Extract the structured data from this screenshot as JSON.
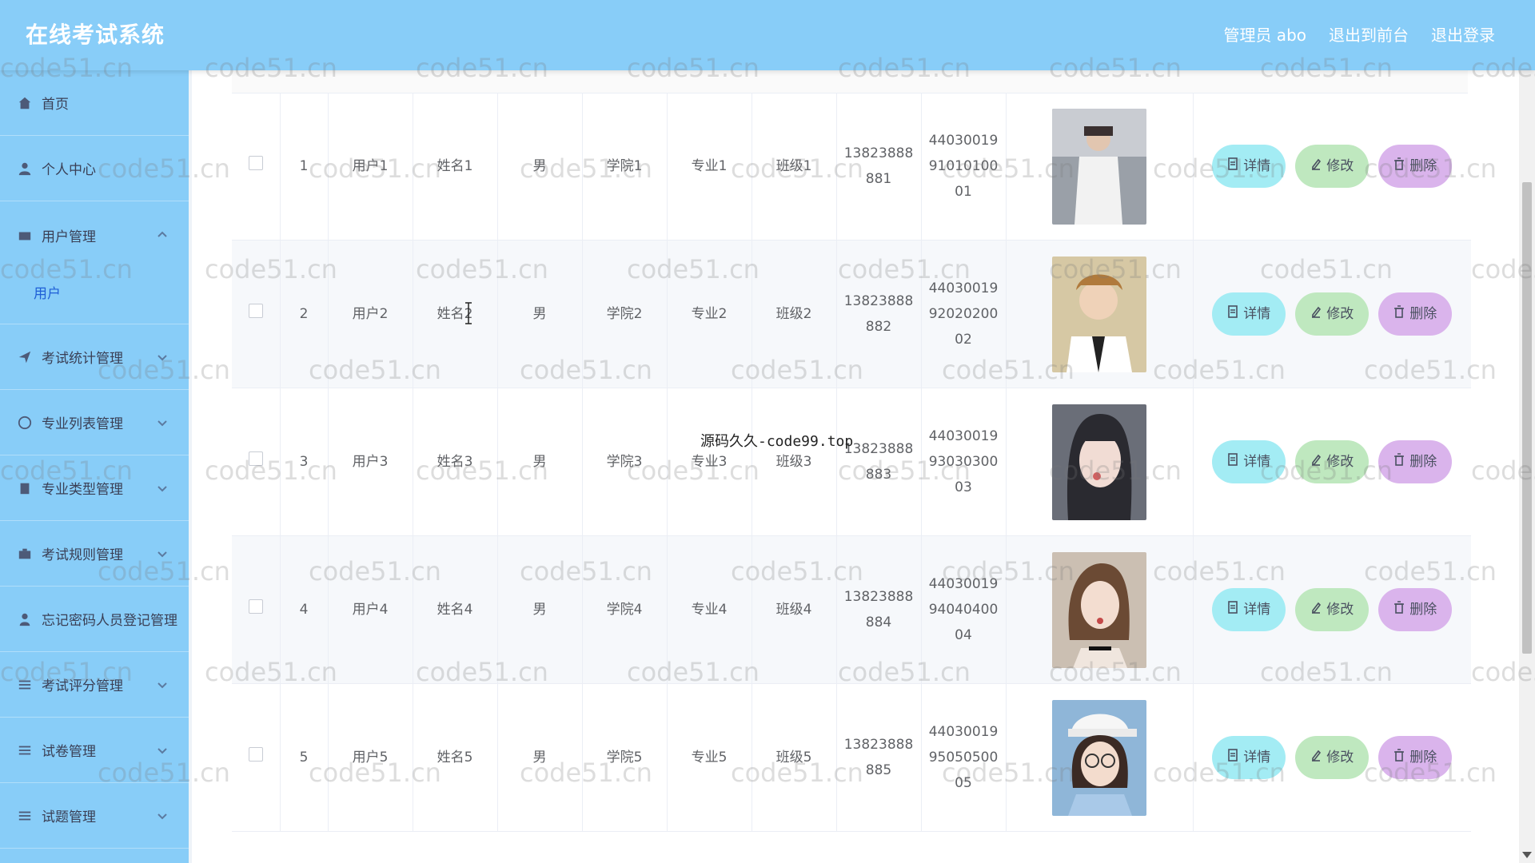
{
  "header": {
    "app_title": "在线考试系统",
    "admin": "管理员 abo",
    "link_front": "退出到前台",
    "link_logout": "退出登录"
  },
  "sidebar": {
    "items": [
      {
        "label": "首页",
        "icon": "home-icon"
      },
      {
        "label": "个人中心",
        "icon": "user-icon"
      },
      {
        "label": "用户管理",
        "icon": "users-icon",
        "submenu": "用户"
      },
      {
        "label": "考试统计管理",
        "icon": "send-icon"
      },
      {
        "label": "专业列表管理",
        "icon": "globe-icon"
      },
      {
        "label": "专业类型管理",
        "icon": "clipboard-icon"
      },
      {
        "label": "考试规则管理",
        "icon": "briefcase-icon"
      },
      {
        "label": "忘记密码人员登记管理",
        "icon": "person-icon"
      },
      {
        "label": "考试评分管理",
        "icon": "sliders-icon"
      },
      {
        "label": "试卷管理",
        "icon": "list-icon"
      },
      {
        "label": "试题管理",
        "icon": "list-icon"
      }
    ]
  },
  "table": {
    "rows": [
      {
        "index": "1",
        "account": "用户1",
        "name": "姓名1",
        "gender": "男",
        "college": "学院1",
        "major": "专业1",
        "class": "班级1",
        "phone_a": "13823888",
        "phone_b": "881",
        "id_a": "44030019",
        "id_b": "91010100",
        "id_c": "01"
      },
      {
        "index": "2",
        "account": "用户2",
        "name": "姓名2",
        "gender": "男",
        "college": "学院2",
        "major": "专业2",
        "class": "班级2",
        "phone_a": "13823888",
        "phone_b": "882",
        "id_a": "44030019",
        "id_b": "92020200",
        "id_c": "02"
      },
      {
        "index": "3",
        "account": "用户3",
        "name": "姓名3",
        "gender": "男",
        "college": "学院3",
        "major": "专业3",
        "class": "班级3",
        "phone_a": "13823888",
        "phone_b": "883",
        "id_a": "44030019",
        "id_b": "93030300",
        "id_c": "03"
      },
      {
        "index": "4",
        "account": "用户4",
        "name": "姓名4",
        "gender": "男",
        "college": "学院4",
        "major": "专业4",
        "class": "班级4",
        "phone_a": "13823888",
        "phone_b": "884",
        "id_a": "44030019",
        "id_b": "94040400",
        "id_c": "04"
      },
      {
        "index": "5",
        "account": "用户5",
        "name": "姓名5",
        "gender": "男",
        "college": "学院5",
        "major": "专业5",
        "class": "班级5",
        "phone_a": "13823888",
        "phone_b": "885",
        "id_a": "44030019",
        "id_b": "95050500",
        "id_c": "05"
      }
    ],
    "actions": {
      "detail": "详情",
      "edit": "修改",
      "delete": "删除"
    }
  },
  "watermark": {
    "text": "code51.cn",
    "center_text": "源码久久-code99.top"
  },
  "colors": {
    "header_bg": "#88cdf8",
    "sidebar_bg": "#88cdf8",
    "detail_btn": "#a3ecf4",
    "edit_btn": "#bfe8bf",
    "delete_btn": "#dab4ec"
  }
}
